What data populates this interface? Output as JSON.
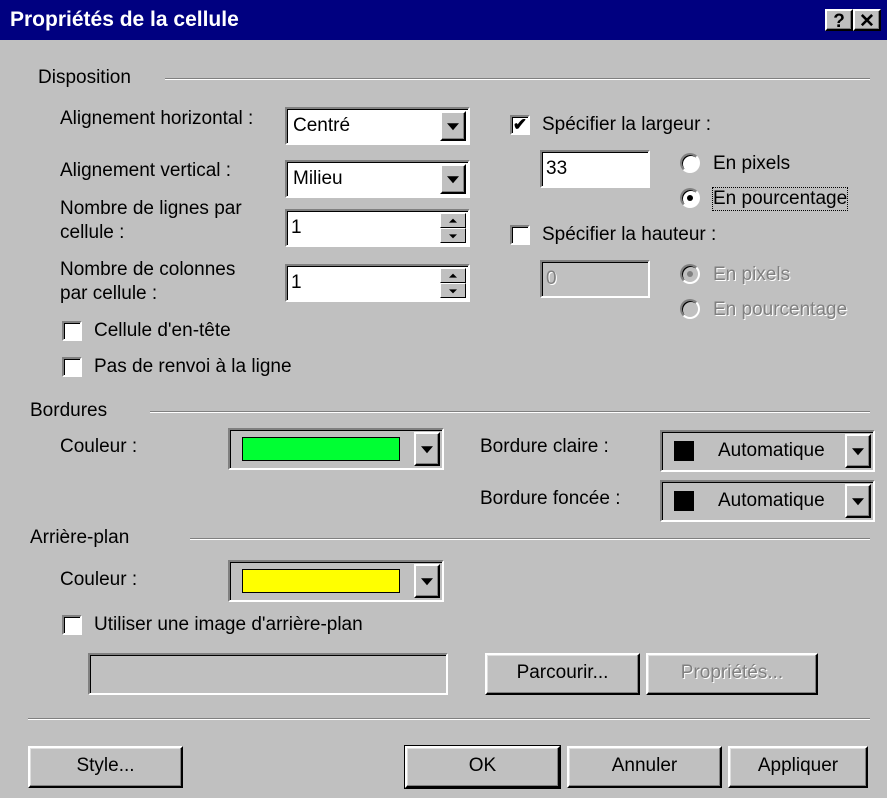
{
  "dialog": {
    "title": "Propriétés de la cellule",
    "help_button": "?",
    "close_button": "✕"
  },
  "disposition": {
    "group_label": "Disposition",
    "h_align_label": "Alignement horizontal :",
    "h_align_value": "Centré",
    "v_align_label": "Alignement vertical :",
    "v_align_value": "Milieu",
    "rows_label_line1": "Nombre de lignes par",
    "rows_label_line2": "cellule :",
    "rows_value": "1",
    "cols_label_line1": "Nombre de colonnes",
    "cols_label_line2": "par cellule :",
    "cols_value": "1",
    "header_cell_label": "Cellule d'en-tête",
    "header_cell_checked": false,
    "no_wrap_label": "Pas de renvoi à la ligne",
    "no_wrap_checked": false,
    "specify_width_label": "Spécifier la largeur :",
    "specify_width_checked": true,
    "width_value": "33",
    "width_pixels_label": "En pixels",
    "width_percent_label": "En pourcentage",
    "width_unit_selected": "percent",
    "specify_height_label": "Spécifier la hauteur :",
    "specify_height_checked": false,
    "height_value": "0",
    "height_pixels_label": "En pixels",
    "height_percent_label": "En pourcentage",
    "height_unit_selected": "pixels"
  },
  "bordures": {
    "group_label": "Bordures",
    "color_label": "Couleur :",
    "color_value": "#00ff33",
    "light_border_label": "Bordure claire :",
    "light_border_value": "Automatique",
    "dark_border_label": "Bordure foncée :",
    "dark_border_value": "Automatique"
  },
  "arriere_plan": {
    "group_label": "Arrière-plan",
    "color_label": "Couleur :",
    "color_value": "#ffff00",
    "use_image_label": "Utiliser une image d'arrière-plan",
    "use_image_checked": false,
    "image_path": "",
    "browse_button": "Parcourir...",
    "properties_button": "Propriétés..."
  },
  "footer": {
    "style_button": "Style...",
    "ok_button": "OK",
    "cancel_button": "Annuler",
    "apply_button": "Appliquer"
  },
  "colors": {
    "face": "#c0c0c0",
    "titlebar": "#000080"
  }
}
